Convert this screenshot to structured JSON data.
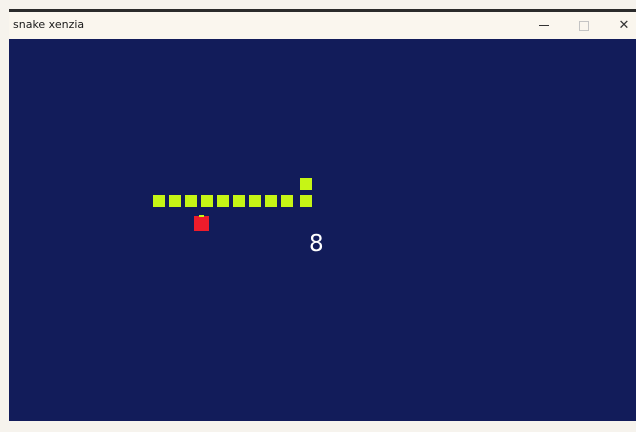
{
  "window": {
    "title": "snake xenzia",
    "minimize_label": "–",
    "close_label": "✕"
  },
  "game": {
    "score": "8",
    "board_color": "#121c5a",
    "snake_color": "#c6f515",
    "food_color": "#ee1c2b",
    "snake_length": 11
  }
}
